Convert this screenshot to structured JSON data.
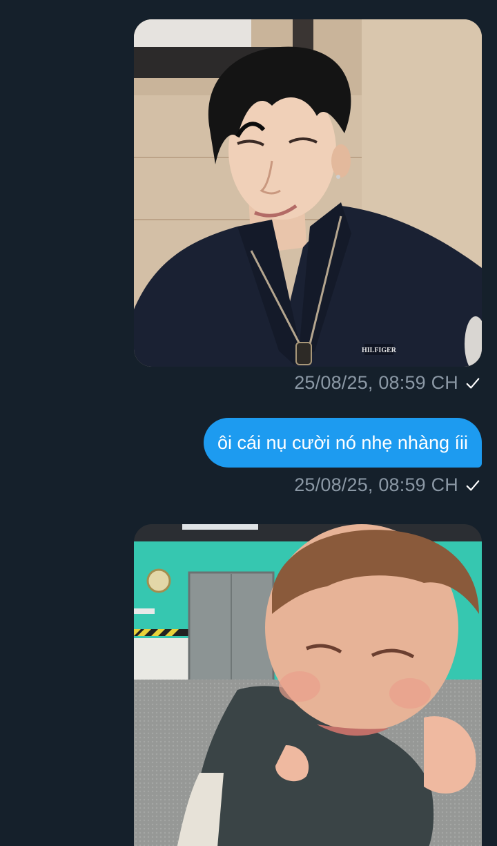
{
  "messages": [
    {
      "type": "image",
      "alt": "man in dark zip jacket smiling",
      "timestamp": "25/08/25, 08:59 CH",
      "status_icon": "check-icon"
    },
    {
      "type": "text",
      "text": "ôi cái nụ cười nó nhẹ nhàng íii",
      "timestamp": "25/08/25, 08:59 CH",
      "status_icon": "check-icon"
    },
    {
      "type": "image",
      "alt": "toddler grinning shyly"
    }
  ],
  "photo_1": {
    "jacket_logo": "HILFIGER"
  },
  "colors": {
    "background": "#15202b",
    "bubble": "#1d9bf0",
    "timestamp": "#8b98a5"
  }
}
